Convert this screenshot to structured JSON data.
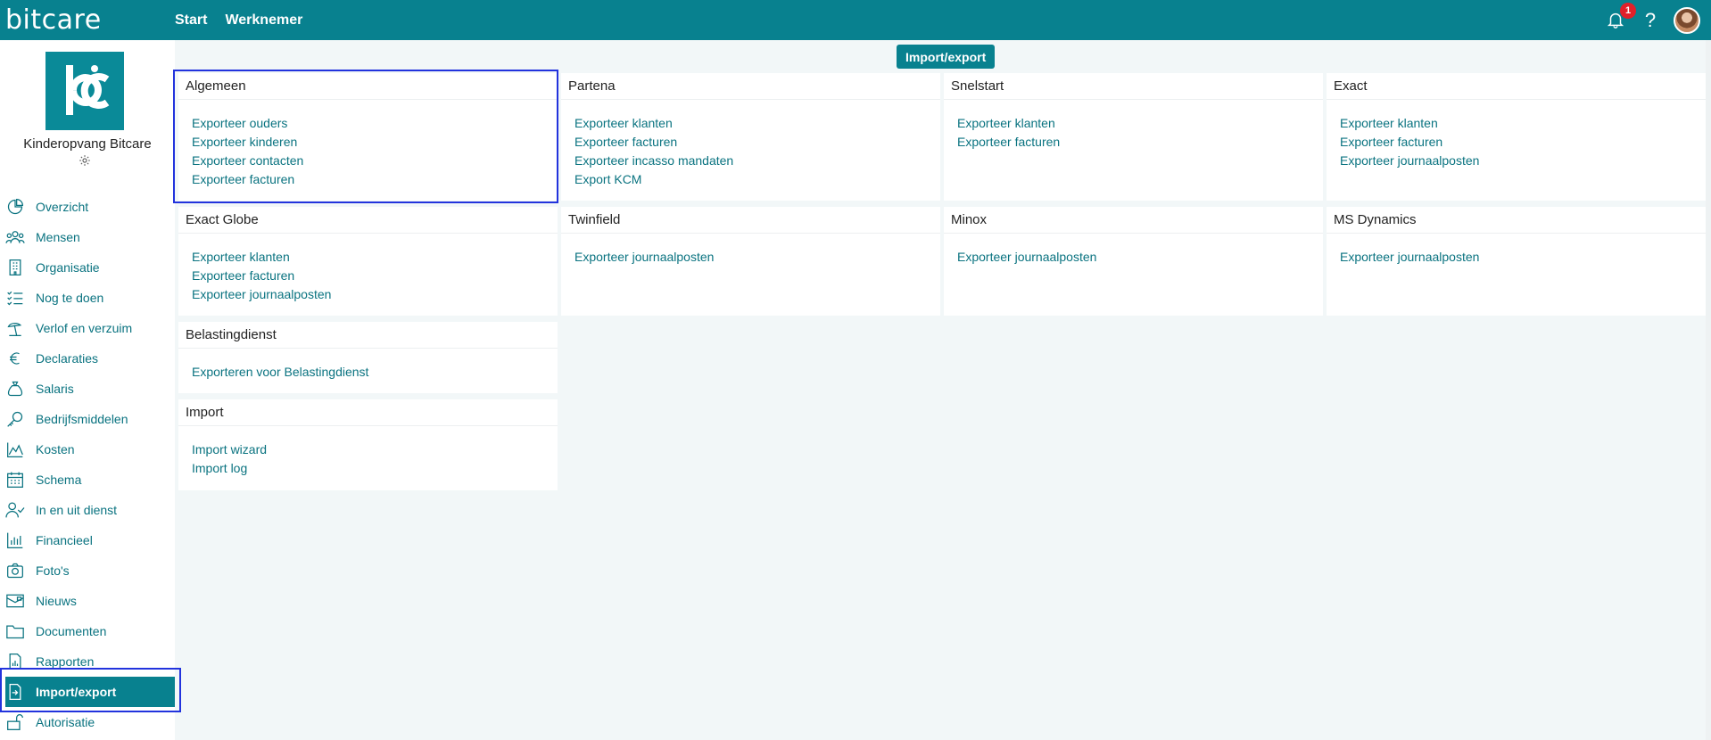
{
  "app": {
    "brand": "bitcare",
    "nav": [
      "Start",
      "Werknemer"
    ],
    "notification_count": "1",
    "help_label": "?"
  },
  "sidebar": {
    "org_name": "Kinderopvang Bitcare",
    "items": [
      {
        "label": "Overzicht",
        "icon": "pie-chart-icon"
      },
      {
        "label": "Mensen",
        "icon": "people-icon"
      },
      {
        "label": "Organisatie",
        "icon": "building-icon"
      },
      {
        "label": "Nog te doen",
        "icon": "checklist-icon"
      },
      {
        "label": "Verlof en verzuim",
        "icon": "beach-icon"
      },
      {
        "label": "Declaraties",
        "icon": "euro-icon"
      },
      {
        "label": "Salaris",
        "icon": "money-bag-icon"
      },
      {
        "label": "Bedrijfsmiddelen",
        "icon": "key-icon"
      },
      {
        "label": "Kosten",
        "icon": "area-chart-icon"
      },
      {
        "label": "Schema",
        "icon": "calendar-icon"
      },
      {
        "label": "In en uit dienst",
        "icon": "user-check-icon"
      },
      {
        "label": "Financieel",
        "icon": "bar-chart-icon"
      },
      {
        "label": "Foto's",
        "icon": "camera-icon"
      },
      {
        "label": "Nieuws",
        "icon": "news-icon"
      },
      {
        "label": "Documenten",
        "icon": "folder-icon"
      },
      {
        "label": "Rapporten",
        "icon": "report-icon"
      },
      {
        "label": "Import/export",
        "icon": "import-export-icon",
        "active": true
      },
      {
        "label": "Autorisatie",
        "icon": "lock-icon"
      }
    ]
  },
  "main": {
    "title": "Import/export",
    "cards": {
      "algemeen": {
        "title": "Algemeen",
        "links": [
          "Exporteer ouders",
          "Exporteer kinderen",
          "Exporteer contacten",
          "Exporteer facturen"
        ]
      },
      "partena": {
        "title": "Partena",
        "links": [
          "Exporteer klanten",
          "Exporteer facturen",
          "Exporteer incasso mandaten",
          "Export KCM"
        ]
      },
      "snelstart": {
        "title": "Snelstart",
        "links": [
          "Exporteer klanten",
          "Exporteer facturen"
        ]
      },
      "exact": {
        "title": "Exact",
        "links": [
          "Exporteer klanten",
          "Exporteer facturen",
          "Exporteer journaalposten"
        ]
      },
      "exact_globe": {
        "title": "Exact Globe",
        "links": [
          "Exporteer klanten",
          "Exporteer facturen",
          "Exporteer journaalposten"
        ]
      },
      "twinfield": {
        "title": "Twinfield",
        "links": [
          "Exporteer journaalposten"
        ]
      },
      "minox": {
        "title": "Minox",
        "links": [
          "Exporteer journaalposten"
        ]
      },
      "ms_dynamics": {
        "title": "MS Dynamics",
        "links": [
          "Exporteer journaalposten"
        ]
      },
      "belastingdienst": {
        "title": "Belastingdienst",
        "links": [
          "Exporteren voor Belastingdienst"
        ]
      },
      "import": {
        "title": "Import",
        "links": [
          "Import wizard",
          "Import log"
        ]
      }
    }
  },
  "colors": {
    "brand": "#08818f",
    "link": "#0a7380",
    "badge": "#e0202a",
    "highlight": "#2233dd"
  }
}
